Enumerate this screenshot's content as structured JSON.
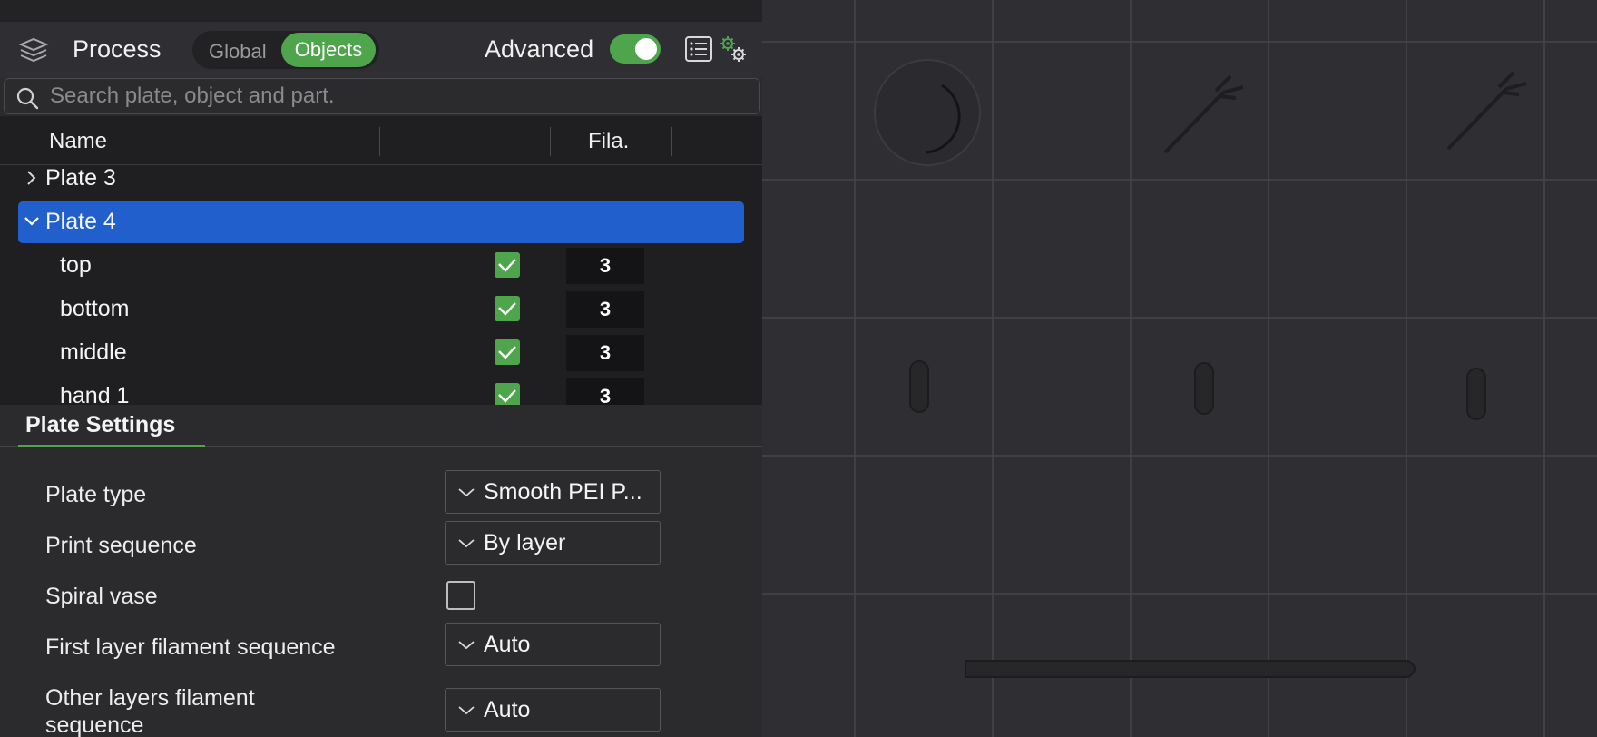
{
  "header": {
    "title": "Process",
    "mode_global": "Global",
    "mode_objects": "Objects",
    "advanced_label": "Advanced",
    "advanced_enabled": true
  },
  "search": {
    "placeholder": "Search plate, object and part."
  },
  "tree": {
    "columns": {
      "name": "Name",
      "filament": "Fila."
    },
    "plates": [
      {
        "label": "Plate 3",
        "expanded": false,
        "selected": false
      },
      {
        "label": "Plate 4",
        "expanded": true,
        "selected": true
      }
    ],
    "parts": [
      {
        "label": "top",
        "checked": true,
        "filament": "3"
      },
      {
        "label": "bottom",
        "checked": true,
        "filament": "3"
      },
      {
        "label": "middle",
        "checked": true,
        "filament": "3"
      },
      {
        "label": "hand 1",
        "checked": true,
        "filament": "3"
      }
    ]
  },
  "plate_settings": {
    "title": "Plate Settings",
    "plate_type_label": "Plate type",
    "plate_type_value": "Smooth PEI P...",
    "print_sequence_label": "Print sequence",
    "print_sequence_value": "By layer",
    "spiral_vase_label": "Spiral vase",
    "spiral_vase_checked": false,
    "first_layer_label": "First layer filament sequence",
    "first_layer_value": "Auto",
    "other_layers_label": "Other layers filament sequence",
    "other_layers_value": "Auto"
  },
  "colors": {
    "accent_green": "#4ea54c",
    "selection_blue": "#2160cc",
    "panel_bg": "#2b2b2e",
    "viewport_bg": "#2e2e33"
  }
}
